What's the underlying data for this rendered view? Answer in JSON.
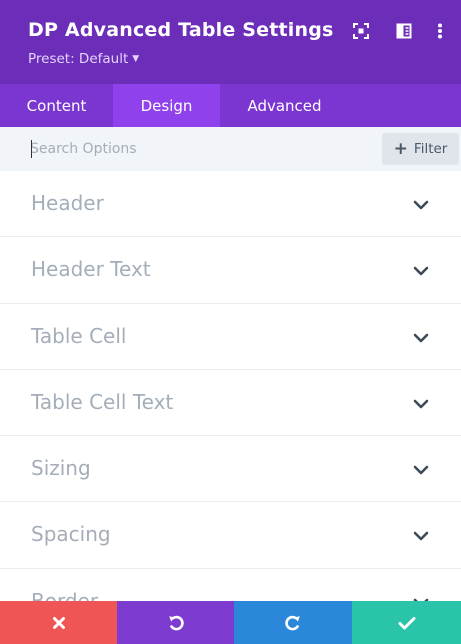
{
  "header": {
    "title": "DP Advanced Table Settings",
    "preset_label": "Preset: Default",
    "icons": [
      "focus-icon",
      "split-view-icon",
      "more-options-icon"
    ]
  },
  "tabs": [
    {
      "label": "Content",
      "active": false
    },
    {
      "label": "Design",
      "active": true
    },
    {
      "label": "Advanced",
      "active": false
    }
  ],
  "search": {
    "placeholder": "Search Options",
    "value": "",
    "filter_label": "Filter"
  },
  "sections": [
    {
      "label": "Header"
    },
    {
      "label": "Header Text"
    },
    {
      "label": "Table Cell"
    },
    {
      "label": "Table Cell Text"
    },
    {
      "label": "Sizing"
    },
    {
      "label": "Spacing"
    },
    {
      "label": "Border"
    }
  ],
  "footer": {
    "buttons": [
      "cancel-icon",
      "undo-icon",
      "redo-icon",
      "save-check-icon"
    ]
  },
  "colors": {
    "header_bg": "#6c2eb9",
    "tabs_bg": "#7b35d0",
    "tab_active_bg": "#8f42ec",
    "cancel": "#ef5555",
    "undo": "#7d3bcf",
    "redo": "#2b87da",
    "save": "#29c4a9"
  }
}
